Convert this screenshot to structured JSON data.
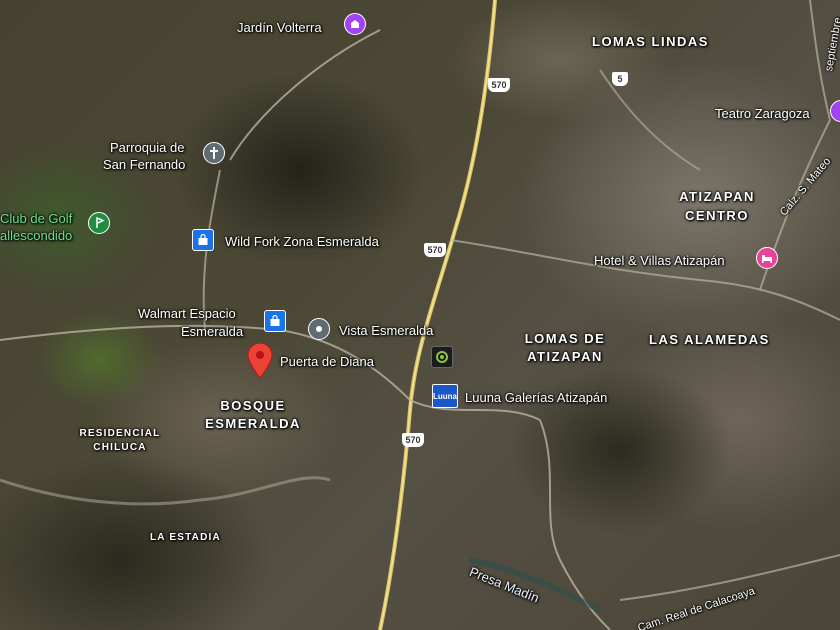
{
  "map": {
    "view": "satellite",
    "pois": {
      "jardin_volterra": "Jardín Volterra",
      "parroquia_1": "Parroquia de",
      "parroquia_2": "San Fernando",
      "club_golf_1": "Club de Golf",
      "club_golf_2": "allescondido",
      "wild_fork": "Wild Fork Zona Esmeralda",
      "walmart_1": "Walmart Espacio",
      "walmart_2": "Esmeralda",
      "vista_esmeralda": "Vista Esmeralda",
      "puerta_diana": "Puerta de Diana",
      "luuna": "Luuna Galerías Atizapán",
      "teatro": "Teatro Zaragoza",
      "hotel": "Hotel & Villas Atizapán"
    },
    "areas": {
      "lomas_lindas": "LOMAS LINDAS",
      "atizapan_1": "ATIZAPAN",
      "atizapan_2": "CENTRO",
      "lomas_atizapan_1": "LOMAS DE",
      "lomas_atizapan_2": "ATIZAPAN",
      "alamedas": "LAS ALAMEDAS",
      "bosque_1": "BOSQUE",
      "bosque_2": "ESMERALDA",
      "chiluca_1": "RESIDENCIAL",
      "chiluca_2": "CHILUCA",
      "estadia": "LA ESTADIA"
    },
    "waterways": {
      "presa": "Presa Madín"
    },
    "streets": {
      "septiembre": "septiembre",
      "s_mateo": "Calz. S. Mateo",
      "real_calacoaya": "Cam. Real de Calacoaya"
    },
    "shields": {
      "r570": "570",
      "r5": "5"
    },
    "luuna_badge": "Luuna",
    "colors": {
      "shopping": "#1a73e8",
      "worship": "#5f6a73",
      "park": "#1e8e3e",
      "attraction": "#a142f4",
      "hotel": "#e8439a",
      "selected_pin": "#ea4335"
    }
  }
}
